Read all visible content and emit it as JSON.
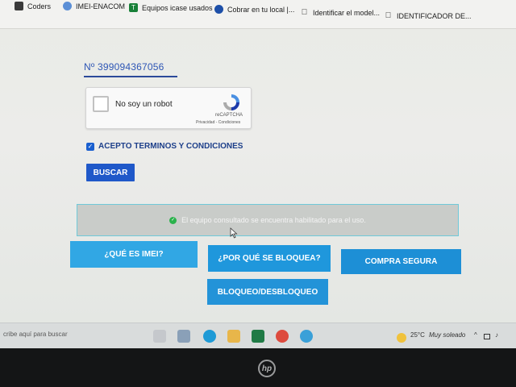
{
  "bookmarks": [
    {
      "label": "Coders",
      "icon": "bookmark-icon"
    },
    {
      "label": "IMEI-ENACOM",
      "icon": "gov-icon"
    },
    {
      "label": "Equipos icase usados",
      "icon": "sheets-icon"
    },
    {
      "label": "Cobrar en tu local |...",
      "icon": "mercadopago-icon"
    },
    {
      "label": "Identificar el model...",
      "icon": "apple-icon"
    },
    {
      "label": "IDENTIFICADOR DE...",
      "icon": "apple-icon"
    }
  ],
  "form": {
    "serial_value": "Nº 399094367056",
    "recaptcha": {
      "label": "No soy un robot",
      "brand": "reCAPTCHA",
      "links": "Privacidad - Condiciones"
    },
    "terms_label": "ACEPTO TERMINOS Y CONDICIONES",
    "terms_checked": true,
    "search_button": "BUSCAR"
  },
  "result": {
    "message": "El equipo consultado se encuentra habilitado para el uso.",
    "status_color": "#2bb24c"
  },
  "info_buttons": {
    "what_is_imei": "¿QUÉ ES IMEI?",
    "why_blocked": "¿POR QUÉ SE BLOQUEA?",
    "safe_purchase": "COMPRA SEGURA",
    "lock_unlock": "BLOQUEO/DESBLOQUEO"
  },
  "taskbar": {
    "search_placeholder": "cribe aquí para buscar",
    "weather_temp": "25°C",
    "weather_desc": "Muy soleado"
  },
  "colors": {
    "accent": "#1f58c9",
    "info_button": "#2a9fe0"
  }
}
